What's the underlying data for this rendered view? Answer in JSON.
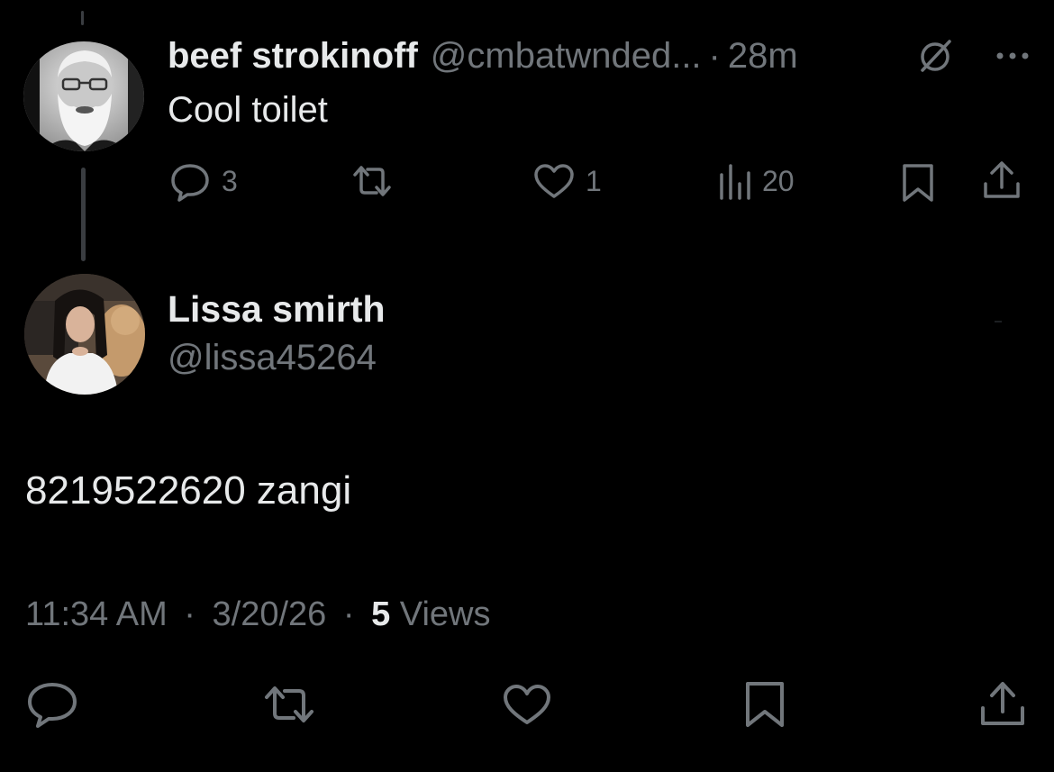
{
  "parent_tweet": {
    "display_name": "beef strokinoff",
    "handle": "@cmbatwnded...",
    "separator": "·",
    "time": "28m",
    "text": "Cool toilet",
    "actions": {
      "replies": "3",
      "retweets": "",
      "likes": "1",
      "views": "20"
    },
    "icons": [
      "grok-icon",
      "more-icon",
      "reply-icon",
      "retweet-icon",
      "like-icon",
      "views-icon",
      "bookmark-icon",
      "share-icon"
    ]
  },
  "reply_tweet": {
    "display_name": "Lissa smirth",
    "handle": "@lissa45264",
    "text": "8219522620 zangi",
    "time": "11:34 AM",
    "date": "3/20/26",
    "separator": "·",
    "views_count": "5",
    "views_label": "Views",
    "icons": [
      "reply-icon",
      "retweet-icon",
      "like-icon",
      "bookmark-icon",
      "share-icon"
    ]
  },
  "colors": {
    "background": "#000000",
    "text_primary": "#e7e9ea",
    "text_secondary": "#71767b",
    "thread_line": "#3a3d41"
  }
}
